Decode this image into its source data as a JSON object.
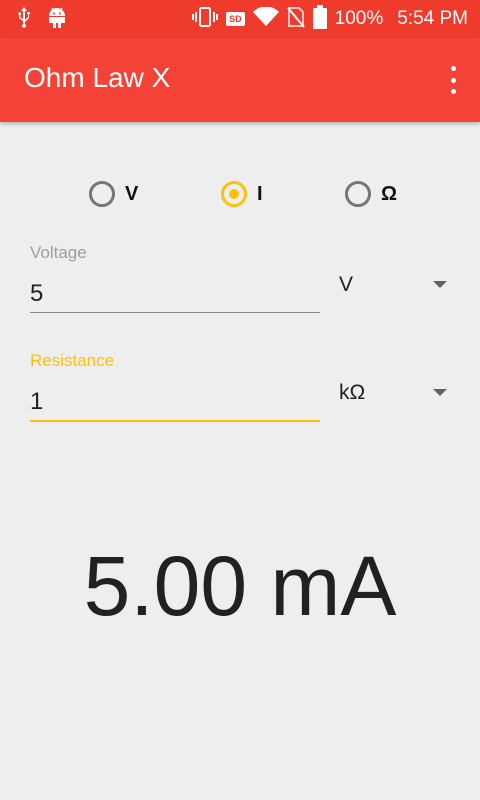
{
  "status_bar": {
    "battery": "100%",
    "time": "5:54 PM",
    "sd_badge": "SD"
  },
  "app_bar": {
    "title": "Ohm Law X"
  },
  "radios": [
    {
      "label": "V",
      "checked": false
    },
    {
      "label": "I",
      "checked": true
    },
    {
      "label": "Ω",
      "checked": false
    }
  ],
  "voltage": {
    "label": "Voltage",
    "value": "5",
    "unit": "V"
  },
  "resistance": {
    "label": "Resistance",
    "value": "1",
    "unit": "kΩ"
  },
  "result": "5.00 mA",
  "colors": {
    "status_bar": "#ef3b2c",
    "app_bar": "#f44336",
    "accent": "#ffc107",
    "background": "#eeeeee"
  }
}
